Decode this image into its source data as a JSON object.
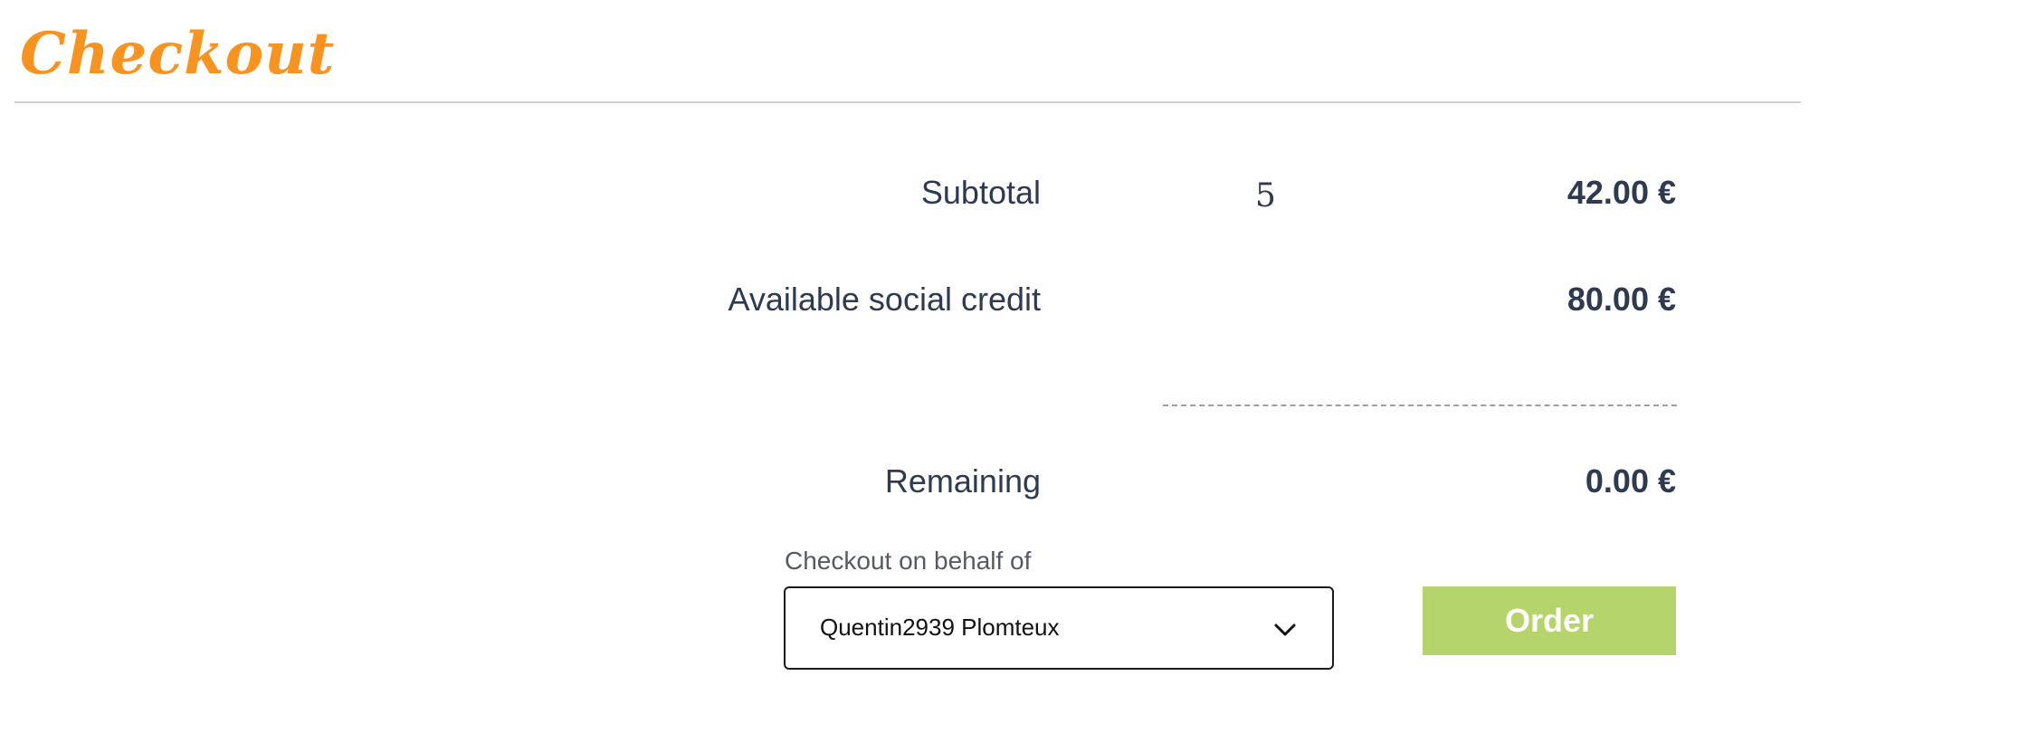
{
  "header": {
    "title": "Checkout"
  },
  "summary": {
    "subtotal": {
      "label": "Subtotal",
      "quantity": "5",
      "value": "42.00 €"
    },
    "social_credit": {
      "label": "Available social credit",
      "value": "80.00 €"
    },
    "remaining": {
      "label": "Remaining",
      "value": "0.00 €"
    }
  },
  "checkout_form": {
    "behalf_label": "Checkout on behalf of",
    "behalf_selected": "Quentin2939 Plomteux",
    "order_button": "Order"
  },
  "colors": {
    "title": "#f7931e",
    "text": "#2e3a4f",
    "order_button": "#b5d56c"
  },
  "icons": {
    "select_indicator": "chevron-down-icon"
  }
}
